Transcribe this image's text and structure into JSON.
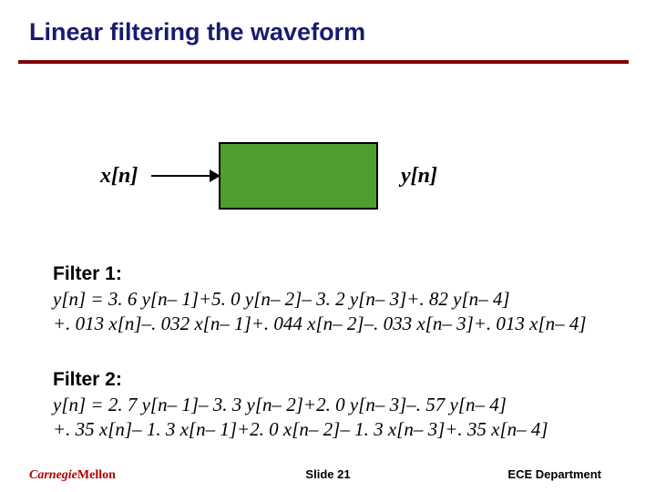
{
  "title": "Linear filtering the waveform",
  "diagram": {
    "x": "x[n]",
    "y": "y[n]"
  },
  "filter1": {
    "head": "Filter 1:",
    "line1": "y[n] = 3. 6 y[n– 1]+5. 0 y[n– 2]– 3. 2 y[n– 3]+. 82 y[n– 4]",
    "line2": "+. 013 x[n]–. 032 x[n– 1]+. 044 x[n– 2]–. 033 x[n– 3]+. 013 x[n– 4]"
  },
  "filter2": {
    "head": "Filter 2:",
    "line1": "y[n] = 2. 7 y[n– 1]– 3. 3 y[n– 2]+2. 0 y[n– 3]–. 57 y[n– 4]",
    "line2": "+. 35 x[n]– 1. 3 x[n– 1]+2. 0 x[n– 2]– 1. 3 x[n– 3]+. 35 x[n– 4]"
  },
  "footer": {
    "slide": "Slide 21",
    "dept": "ECE Department",
    "logo1": "Carnegie",
    "logo2": "Mellon"
  }
}
